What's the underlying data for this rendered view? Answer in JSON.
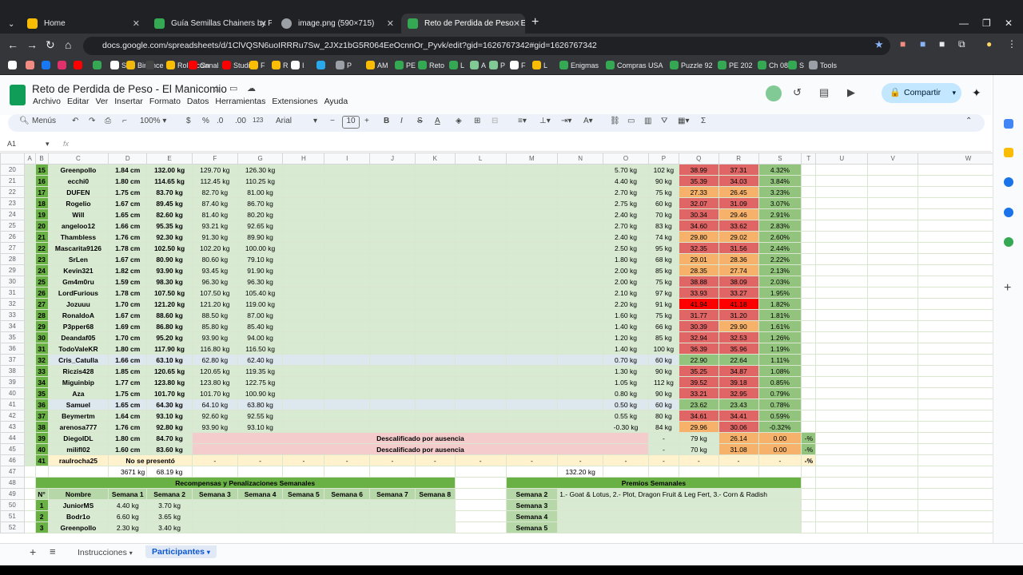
{
  "browser": {
    "tabs": [
      {
        "label": "Home",
        "color": "#fbbc04"
      },
      {
        "label": "Guía Semillas Chainers by Pierc",
        "color": "#34a853"
      },
      {
        "label": "image.png (590×715)",
        "color": "#9aa0a6"
      },
      {
        "label": "Reto de Perdida de Peso - El M",
        "color": "#34a853"
      }
    ],
    "url": "docs.google.com/spreadsheets/d/1ClVQSN6uoIRRRu7Sw_2JXz1bG5R064EeOcnnOr_Pyvk/edit?gid=1626767342#gid=1626767342",
    "bookmarks": [
      "",
      "",
      "",
      "",
      "",
      "",
      "S",
      "Binance",
      "",
      "Rollercoin",
      "Canal",
      "Studio",
      "F",
      "R",
      "I",
      "",
      "P",
      "AM",
      "PE",
      "Reto",
      "L",
      "A",
      "P",
      "F",
      "L",
      "Enigmas",
      "Compras USA",
      "Puzzle 92",
      "PE 202",
      "Ch 08",
      "S",
      "Tools"
    ]
  },
  "sheet": {
    "title": "Reto de Perdida de Peso - El Manicomio",
    "menus": [
      "Archivo",
      "Editar",
      "Ver",
      "Insertar",
      "Formato",
      "Datos",
      "Herramientas",
      "Extensiones",
      "Ayuda"
    ],
    "share_label": "Compartir",
    "toolbar": {
      "search": "Menús",
      "zoom": "100%",
      "currency": "$",
      "percent": "%",
      "dec_less": ".0",
      "dec_more": ".00",
      "format123": "123",
      "font": "Arial",
      "size": "10"
    },
    "cell_ref": "A1",
    "fx": "fx",
    "col_headers": [
      "A",
      "B",
      "C",
      "D",
      "E",
      "F",
      "G",
      "H",
      "I",
      "J",
      "K",
      "L",
      "M",
      "N",
      "O",
      "P",
      "Q",
      "R",
      "S",
      "T",
      "U",
      "V",
      "W"
    ],
    "rows": [
      {
        "r": "20",
        "n": "15",
        "name": "Greenpollo",
        "d": "1.84 cm",
        "e": "132.00 kg",
        "f": "129.70 kg",
        "g": "126.30 kg",
        "o": "5.70 kg",
        "p": "102 kg",
        "q": "38.99",
        "qc": "red",
        "rv": "37.31",
        "rc": "red",
        "s": "4.32%"
      },
      {
        "r": "21",
        "n": "16",
        "name": "ecchi0",
        "d": "1.80 cm",
        "e": "114.65 kg",
        "f": "112.45 kg",
        "g": "110.25 kg",
        "o": "4.40 kg",
        "p": "90 kg",
        "q": "35.39",
        "qc": "red",
        "rv": "34.03",
        "rc": "red",
        "s": "3.84%"
      },
      {
        "r": "22",
        "n": "17",
        "name": "DUFEN",
        "d": "1.75 cm",
        "e": "83.70 kg",
        "f": "82.70 kg",
        "g": "81.00 kg",
        "o": "2.70 kg",
        "p": "75 kg",
        "q": "27.33",
        "qc": "org",
        "rv": "26.45",
        "rc": "org",
        "s": "3.23%"
      },
      {
        "r": "23",
        "n": "18",
        "name": "Rogelio",
        "d": "1.67 cm",
        "e": "89.45 kg",
        "f": "87.40 kg",
        "g": "86.70 kg",
        "o": "2.75 kg",
        "p": "60 kg",
        "q": "32.07",
        "qc": "red",
        "rv": "31.09",
        "rc": "red",
        "s": "3.07%"
      },
      {
        "r": "24",
        "n": "19",
        "name": "Will",
        "d": "1.65 cm",
        "e": "82.60 kg",
        "f": "81.40 kg",
        "g": "80.20 kg",
        "o": "2.40 kg",
        "p": "70 kg",
        "q": "30.34",
        "qc": "red",
        "rv": "29.46",
        "rc": "org",
        "s": "2.91%"
      },
      {
        "r": "25",
        "n": "20",
        "name": "angeloo12",
        "d": "1.66 cm",
        "e": "95.35 kg",
        "f": "93.21 kg",
        "g": "92.65 kg",
        "o": "2.70 kg",
        "p": "83 kg",
        "q": "34.60",
        "qc": "red",
        "rv": "33.62",
        "rc": "red",
        "s": "2.83%"
      },
      {
        "r": "26",
        "n": "21",
        "name": "Thambless",
        "d": "1.76 cm",
        "e": "92.30 kg",
        "f": "91.30 kg",
        "g": "89.90 kg",
        "o": "2.40 kg",
        "p": "74 kg",
        "q": "29.80",
        "qc": "org",
        "rv": "29.02",
        "rc": "org",
        "s": "2.60%"
      },
      {
        "r": "27",
        "n": "22",
        "name": "Mascarita9126",
        "d": "1.78 cm",
        "e": "102.50 kg",
        "f": "102.20 kg",
        "g": "100.00 kg",
        "o": "2.50 kg",
        "p": "95 kg",
        "q": "32.35",
        "qc": "red",
        "rv": "31.56",
        "rc": "red",
        "s": "2.44%"
      },
      {
        "r": "28",
        "n": "23",
        "name": "SrLen",
        "d": "1.67 cm",
        "e": "80.90 kg",
        "f": "80.60 kg",
        "g": "79.10 kg",
        "o": "1.80 kg",
        "p": "68 kg",
        "q": "29.01",
        "qc": "org",
        "rv": "28.36",
        "rc": "org",
        "s": "2.22%"
      },
      {
        "r": "29",
        "n": "24",
        "name": "Kevin321",
        "d": "1.82 cm",
        "e": "93.90 kg",
        "f": "93.45 kg",
        "g": "91.90 kg",
        "o": "2.00 kg",
        "p": "85 kg",
        "q": "28.35",
        "qc": "org",
        "rv": "27.74",
        "rc": "org",
        "s": "2.13%"
      },
      {
        "r": "30",
        "n": "25",
        "name": "Gm4m0ru",
        "d": "1.59 cm",
        "e": "98.30 kg",
        "f": "96.30 kg",
        "g": "96.30 kg",
        "o": "2.00 kg",
        "p": "75 kg",
        "q": "38.88",
        "qc": "red",
        "rv": "38.09",
        "rc": "red",
        "s": "2.03%"
      },
      {
        "r": "31",
        "n": "26",
        "name": "LordFurious",
        "d": "1.78 cm",
        "e": "107.50 kg",
        "f": "107.50 kg",
        "g": "105.40 kg",
        "o": "2.10 kg",
        "p": "97 kg",
        "q": "33.93",
        "qc": "red",
        "rv": "33.27",
        "rc": "red",
        "s": "1.95%"
      },
      {
        "r": "32",
        "n": "27",
        "name": "Jozuuu",
        "d": "1.70 cm",
        "e": "121.20 kg",
        "f": "121.20 kg",
        "g": "119.00 kg",
        "o": "2.20 kg",
        "p": "91 kg",
        "q": "41.94",
        "qc": "bright",
        "rv": "41.18",
        "rc": "bright",
        "s": "1.82%"
      },
      {
        "r": "33",
        "n": "28",
        "name": "RonaldoA",
        "d": "1.67 cm",
        "e": "88.60 kg",
        "f": "88.50 kg",
        "g": "87.00 kg",
        "o": "1.60 kg",
        "p": "75 kg",
        "q": "31.77",
        "qc": "red",
        "rv": "31.20",
        "rc": "red",
        "s": "1.81%"
      },
      {
        "r": "34",
        "n": "29",
        "name": "P3pper68",
        "d": "1.69 cm",
        "e": "86.80 kg",
        "f": "85.80 kg",
        "g": "85.40 kg",
        "o": "1.40 kg",
        "p": "66 kg",
        "q": "30.39",
        "qc": "red",
        "rv": "29.90",
        "rc": "org",
        "s": "1.61%"
      },
      {
        "r": "35",
        "n": "30",
        "name": "Deandaf05",
        "d": "1.70 cm",
        "e": "95.20 kg",
        "f": "93.90 kg",
        "g": "94.00 kg",
        "o": "1.20 kg",
        "p": "85 kg",
        "q": "32.94",
        "qc": "red",
        "rv": "32.53",
        "rc": "red",
        "s": "1.26%"
      },
      {
        "r": "36",
        "n": "31",
        "name": "TodoValeKR",
        "d": "1.80 cm",
        "e": "117.90 kg",
        "f": "116.80 kg",
        "g": "116.50 kg",
        "o": "1.40 kg",
        "p": "100 kg",
        "q": "36.39",
        "qc": "red",
        "rv": "35.96",
        "rc": "red",
        "s": "1.19%"
      },
      {
        "r": "37",
        "n": "32",
        "name": "Cris_Catulla",
        "d": "1.66 cm",
        "e": "63.10 kg",
        "f": "62.80 kg",
        "g": "62.40 kg",
        "o": "0.70 kg",
        "p": "60 kg",
        "q": "22.90",
        "qc": "pg",
        "rv": "22.64",
        "rc": "pg",
        "s": "1.11%",
        "blue": true
      },
      {
        "r": "38",
        "n": "33",
        "name": "Riczis428",
        "d": "1.85 cm",
        "e": "120.65 kg",
        "f": "120.65 kg",
        "g": "119.35 kg",
        "o": "1.30 kg",
        "p": "90 kg",
        "q": "35.25",
        "qc": "red",
        "rv": "34.87",
        "rc": "red",
        "s": "1.08%"
      },
      {
        "r": "39",
        "n": "34",
        "name": "Miguinbip",
        "d": "1.77 cm",
        "e": "123.80 kg",
        "f": "123.80 kg",
        "g": "122.75 kg",
        "o": "1.05 kg",
        "p": "112 kg",
        "q": "39.52",
        "qc": "red",
        "rv": "39.18",
        "rc": "red",
        "s": "0.85%"
      },
      {
        "r": "40",
        "n": "35",
        "name": "Aza",
        "d": "1.75 cm",
        "e": "101.70 kg",
        "f": "101.70 kg",
        "g": "100.90 kg",
        "o": "0.80 kg",
        "p": "90 kg",
        "q": "33.21",
        "qc": "red",
        "rv": "32.95",
        "rc": "red",
        "s": "0.79%"
      },
      {
        "r": "41",
        "n": "36",
        "name": "Samuel",
        "d": "1.65 cm",
        "e": "64.30 kg",
        "f": "64.10 kg",
        "g": "63.80 kg",
        "o": "0.50 kg",
        "p": "60 kg",
        "q": "23.62",
        "qc": "pg",
        "rv": "23.43",
        "rc": "pg",
        "s": "0.78%",
        "blue": true
      },
      {
        "r": "42",
        "n": "37",
        "name": "Beymertm",
        "d": "1.64 cm",
        "e": "93.10 kg",
        "f": "92.60 kg",
        "g": "92.55 kg",
        "o": "0.55 kg",
        "p": "80 kg",
        "q": "34.61",
        "qc": "red",
        "rv": "34.41",
        "rc": "red",
        "s": "0.59%"
      },
      {
        "r": "43",
        "n": "38",
        "name": "arenosa777",
        "d": "1.76 cm",
        "e": "92.80 kg",
        "f": "93.90 kg",
        "g": "93.10 kg",
        "o": "-0.30 kg",
        "p": "84 kg",
        "q": "29.96",
        "qc": "org",
        "rv": "30.06",
        "rc": "red",
        "s": "-0.32%"
      }
    ],
    "dq_rows": [
      {
        "r": "44",
        "n": "39",
        "name": "DiegoIDL",
        "d": "1.80 cm",
        "e": "84.70 kg",
        "label": "Descalificado por ausencia",
        "o": "-",
        "p": "79 kg",
        "q": "26.14",
        "rv": "0.00",
        "s": "-%"
      },
      {
        "r": "45",
        "n": "40",
        "name": "milifl02",
        "d": "1.60 cm",
        "e": "83.60 kg",
        "label": "Descalificado por ausencia",
        "o": "-",
        "p": "70 kg",
        "q": "31.08",
        "rv": "0.00",
        "s": "-%"
      }
    ],
    "row46": {
      "r": "46",
      "n": "41",
      "name": "raulrocha25",
      "cd": "No se presentó",
      "dash": "-",
      "s": "-%"
    },
    "row47": {
      "r": "47",
      "e": "3671 kg",
      "f": "68.19 kg",
      "o": "132.20 kg"
    },
    "row48": {
      "r": "48",
      "left_title": "Recompensas y Penalizaciones Semanales",
      "right_title": "Premios Semanales"
    },
    "row49": {
      "r": "49",
      "hdrs": [
        "N°",
        "Nombre",
        "Semana 1",
        "Semana 2",
        "Semana 3",
        "Semana 4",
        "Semana 5",
        "Semana 6",
        "Semana 7",
        "Semana 8"
      ],
      "week": "Semana 2",
      "prize": "1.- Goat & Lotus, 2.- Plot, Dragon Fruit & Leg Fert, 3.- Corn & Radish"
    },
    "reward_rows": [
      {
        "r": "50",
        "n": "1",
        "name": "JuniorMS",
        "s1": "4.40 kg",
        "s2": "3.70 kg",
        "week": "Semana 3"
      },
      {
        "r": "51",
        "n": "2",
        "name": "Bodr1o",
        "s1": "6.60 kg",
        "s2": "3.65 kg",
        "week": "Semana 4"
      },
      {
        "r": "52",
        "n": "3",
        "name": "Greenpollo",
        "s1": "2.30 kg",
        "s2": "3.40 kg",
        "week": "Semana 5"
      }
    ],
    "sheet_tabs": [
      "Instrucciones",
      "Participantes"
    ]
  }
}
